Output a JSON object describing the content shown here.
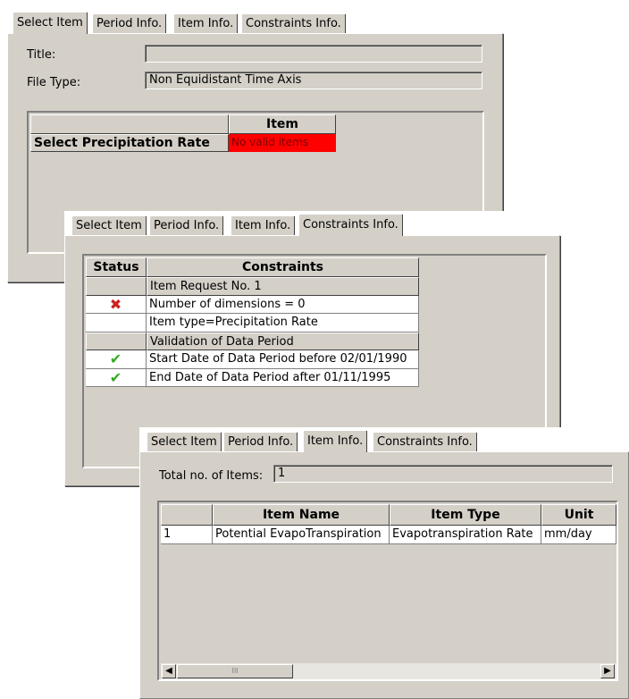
{
  "tabs": [
    "Select Item",
    "Period Info.",
    "Item Info.",
    "Constraints Info."
  ],
  "dialog1": {
    "title_label": "Title:",
    "title_value": "",
    "file_type_label": "File Type:",
    "file_type_value": "Non Equidistant Time Axis",
    "grid": {
      "col_header": "Item",
      "row_label": "Select Precipitation Rate",
      "row_value": "No valid items",
      "row_value_color": "#ff0000"
    }
  },
  "dialog2": {
    "headers": [
      "Status",
      "Constraints"
    ],
    "rows": [
      {
        "type": "group",
        "status": "",
        "text": "Item Request No. 1"
      },
      {
        "type": "data",
        "status": "x-icon",
        "text": "Number of dimensions = 0"
      },
      {
        "type": "data",
        "status": "",
        "text": "Item type=Precipitation Rate"
      },
      {
        "type": "group",
        "status": "",
        "text": "Validation of Data Period"
      },
      {
        "type": "data",
        "status": "check-icon",
        "text": "Start Date of Data Period before 02/01/1990"
      },
      {
        "type": "data",
        "status": "check-icon",
        "text": "End Date of Data Period after 01/11/1995"
      }
    ],
    "colors": {
      "fail": "#cc2222",
      "pass": "#33aa22"
    }
  },
  "dialog3": {
    "total_label": "Total no. of Items:",
    "total_value": "1",
    "headers": [
      "",
      "Item Name",
      "Item Type",
      "Unit"
    ],
    "rows": [
      [
        "1",
        "Potential EvapoTranspiration",
        "Evapotranspiration Rate",
        "mm/day"
      ]
    ],
    "scroll_grip": "III"
  }
}
